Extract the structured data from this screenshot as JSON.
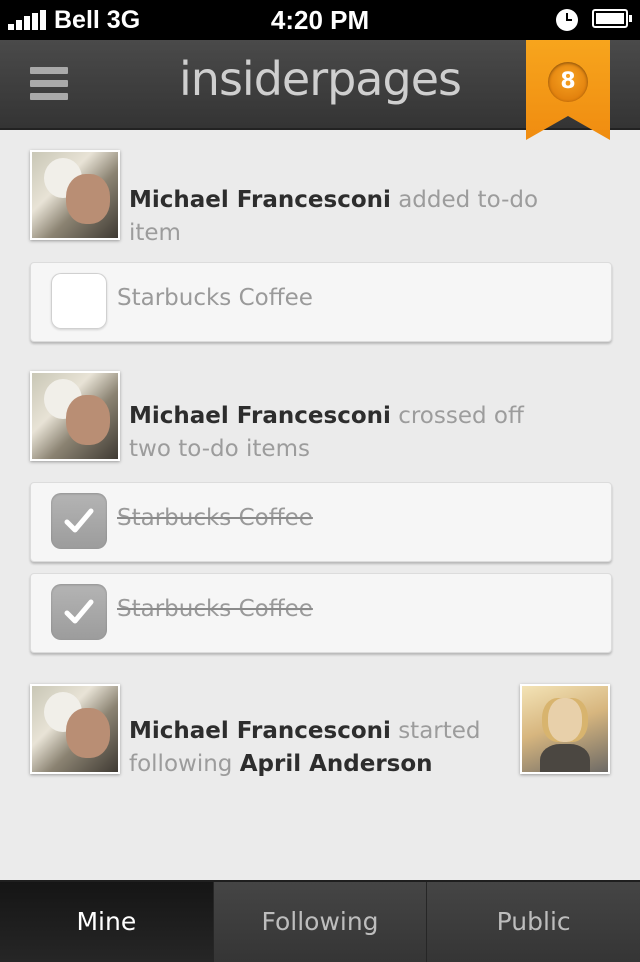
{
  "status_bar": {
    "carrier": "Bell 3G",
    "time": "4:20 PM"
  },
  "header": {
    "app_title": "insiderpages",
    "badge_count": "8"
  },
  "feed": [
    {
      "actor": "Michael Francesconi",
      "action": "added to-do item",
      "todos": [
        {
          "label": "Starbucks Coffee",
          "checked": false
        }
      ]
    },
    {
      "actor": "Michael Francesconi",
      "action": "crossed off two to-do items",
      "todos": [
        {
          "label": "Starbucks Coffee",
          "checked": true
        },
        {
          "label": "Starbucks Coffee",
          "checked": true
        }
      ]
    },
    {
      "actor": "Michael Francesconi",
      "action": "started following",
      "target": "April Anderson"
    }
  ],
  "tabs": [
    {
      "label": "Mine",
      "active": true
    },
    {
      "label": "Following",
      "active": false
    },
    {
      "label": "Public",
      "active": false
    }
  ]
}
